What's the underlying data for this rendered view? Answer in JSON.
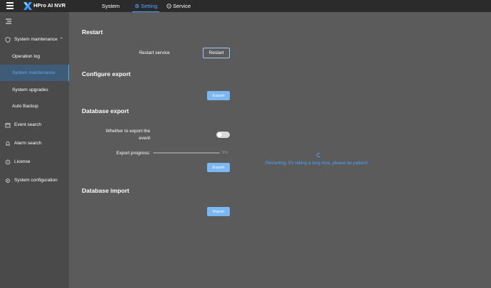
{
  "app": {
    "title": "HPro AI NVR",
    "accent_color": "#4aa3ff"
  },
  "top_nav": {
    "menu_icon": "hamburger-icon",
    "tabs": [
      {
        "label": "System",
        "icon": ""
      },
      {
        "label": "Setting",
        "icon": "gear-icon",
        "active": true
      },
      {
        "label": "Service",
        "icon": "compass-icon"
      }
    ]
  },
  "sidebar": {
    "collapse_icon": "menu-fold-icon",
    "items": [
      {
        "label": "System maintenance",
        "icon": "shield-icon",
        "expanded": true
      },
      {
        "label": "Operation log"
      },
      {
        "label": "System maintenance",
        "active": true
      },
      {
        "label": "System upgrades"
      },
      {
        "label": "Auto Backup"
      },
      {
        "label": "Event search",
        "icon": "event-icon"
      },
      {
        "label": "Alarm search",
        "icon": "bell-icon"
      },
      {
        "label": "License",
        "icon": "license-icon"
      },
      {
        "label": "System configuration",
        "icon": "settings-icon"
      }
    ]
  },
  "main": {
    "restart": {
      "title": "Restart",
      "service_label": "Restart service",
      "button": "Restart"
    },
    "configure_export": {
      "title": "Configure export",
      "button": "Export"
    },
    "database_export": {
      "title": "Database export",
      "event_label_line1": "Whether to export the",
      "event_label_line2": "event",
      "toggle_on": false,
      "progress_label": "Export progress:",
      "progress_value": 0,
      "progress_text": "0%",
      "button": "Export"
    },
    "database_import": {
      "title": "Database import",
      "button": "Import"
    },
    "loading": {
      "icon": "loading-icon",
      "text": "Restarting, it's taking a long time, please be patient!"
    }
  }
}
